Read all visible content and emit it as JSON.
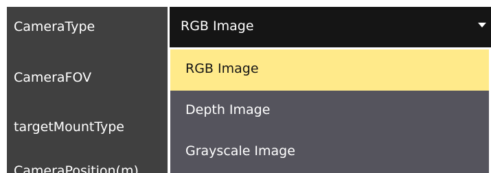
{
  "properties": {
    "labels": [
      "CameraType",
      "CameraFOV",
      "targetMountType",
      "CameraPosition(m)"
    ]
  },
  "camera_type_dropdown": {
    "selected_value": "RGB Image",
    "options": [
      "RGB Image",
      "Depth Image",
      "Grayscale Image"
    ],
    "highlighted_option": "RGB Image"
  },
  "colors": {
    "panel_bg": "#404040",
    "dropdown_header_bg": "#151515",
    "list_bg": "#55545d",
    "highlight": "#ffea8a"
  }
}
